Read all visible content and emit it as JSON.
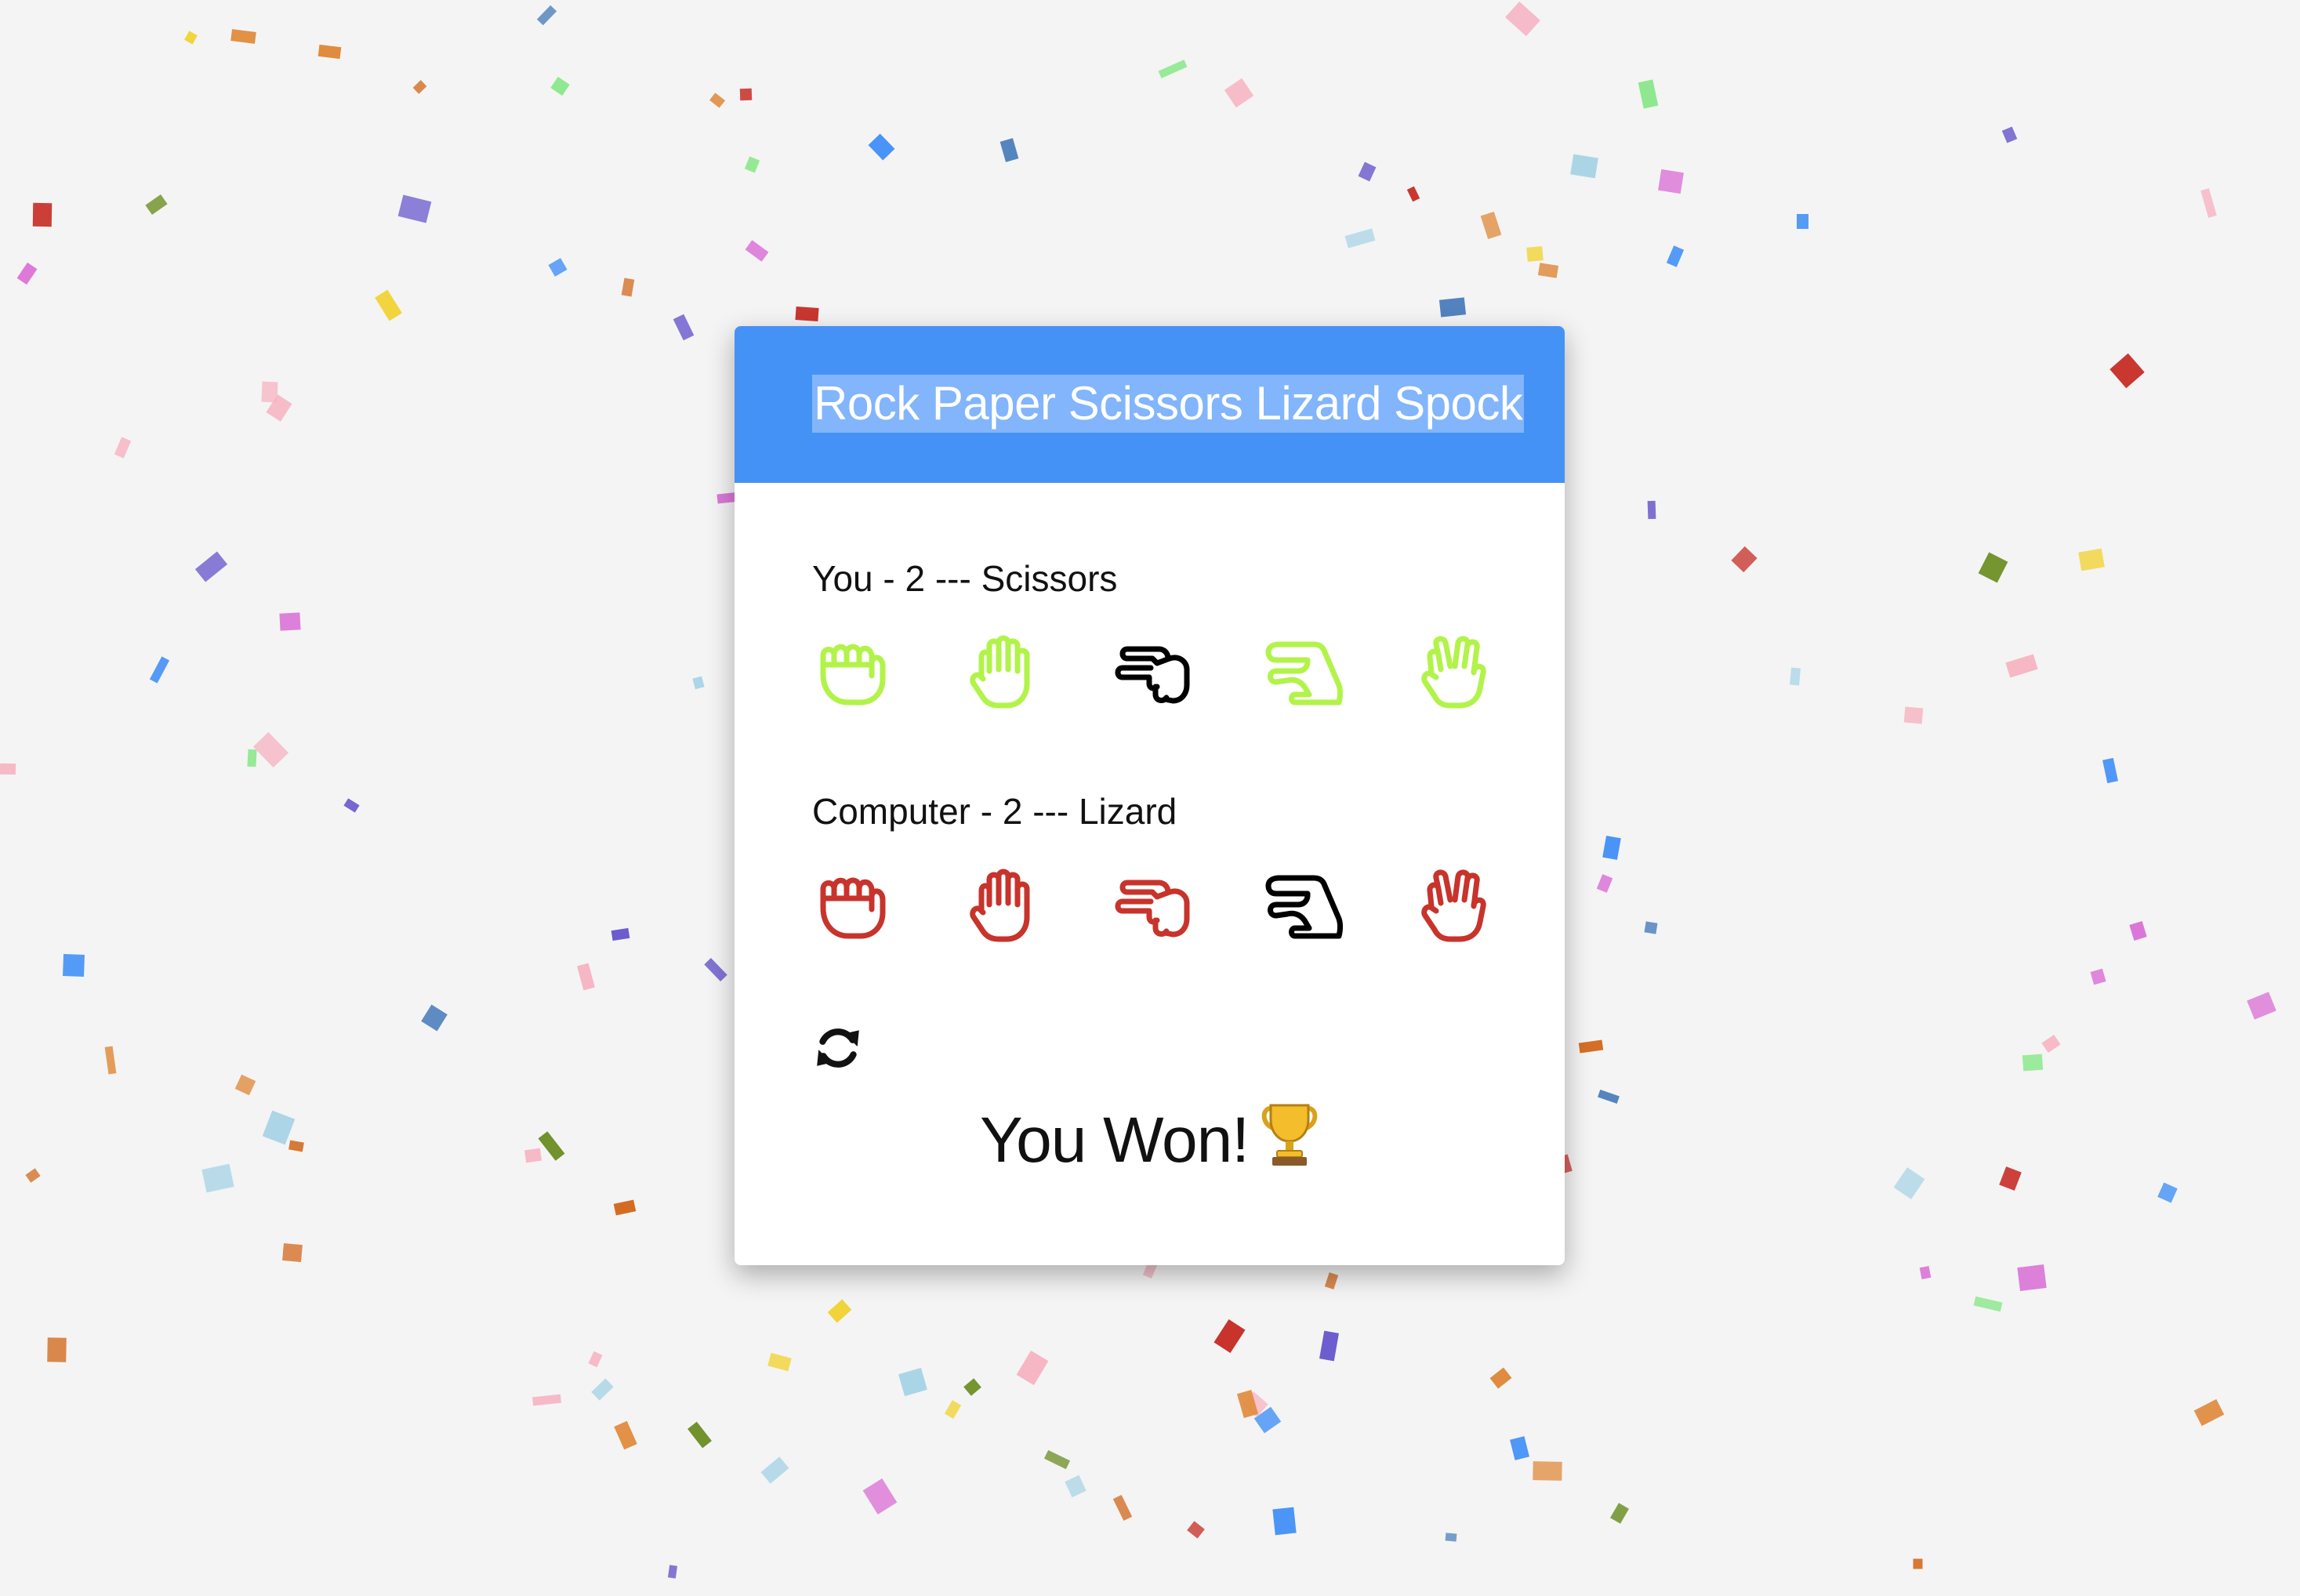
{
  "game": {
    "title": "Rock Paper Scissors Lizard Spock",
    "player_label": "You - 2 --- Scissors",
    "computer_label": "Computer - 2 --- Lizard",
    "result_text": "You Won!",
    "result_icon": "trophy-icon",
    "refresh_icon": "refresh-icon"
  },
  "choices": [
    "Rock",
    "Paper",
    "Scissors",
    "Lizard",
    "Spock"
  ],
  "player": {
    "selected": "Scissors",
    "score": 2,
    "color": "#b2f34a",
    "selected_color": "#000000"
  },
  "computer": {
    "selected": "Lizard",
    "score": 2,
    "color": "#c8332c",
    "selected_color": "#000000"
  },
  "colors": {
    "header": "#4592f6",
    "background": "#f4f4f4",
    "card": "#ffffff"
  }
}
